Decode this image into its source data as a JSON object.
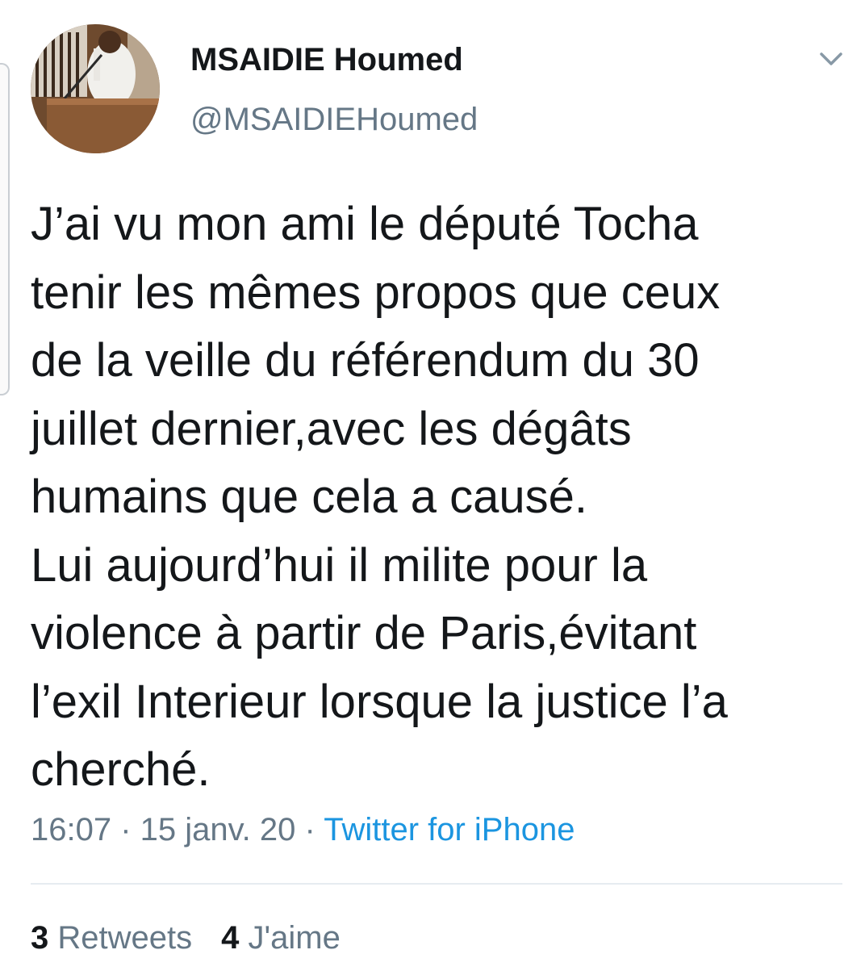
{
  "colors": {
    "text_primary": "#14171a",
    "text_secondary": "#657786",
    "link": "#1b95e0",
    "divider": "#e6ecf0"
  },
  "author": {
    "display_name": "MSAIDIE Houmed",
    "handle": "@MSAIDIEHoumed",
    "avatar_icon": "profile-photo"
  },
  "menu_icon": "chevron-down-icon",
  "tweet": {
    "lines": [
      "J’ai vu mon ami le député Tocha",
      "tenir les mêmes propos que ceux",
      "de la veille du référendum du 30",
      "juillet dernier,avec les dégâts",
      "humains que cela a causé.",
      "Lui aujourd’hui il milite pour la",
      "violence à partir de Paris,évitant",
      "l’exil Interieur lorsque la justice l’a",
      "cherché."
    ]
  },
  "meta": {
    "time": "16:07",
    "separator": " · ",
    "date": "15 janv. 20",
    "source": "Twitter for iPhone"
  },
  "stats": {
    "retweets_count": "3",
    "retweets_label": "Retweets",
    "likes_count": "4",
    "likes_label": "J'aime"
  }
}
